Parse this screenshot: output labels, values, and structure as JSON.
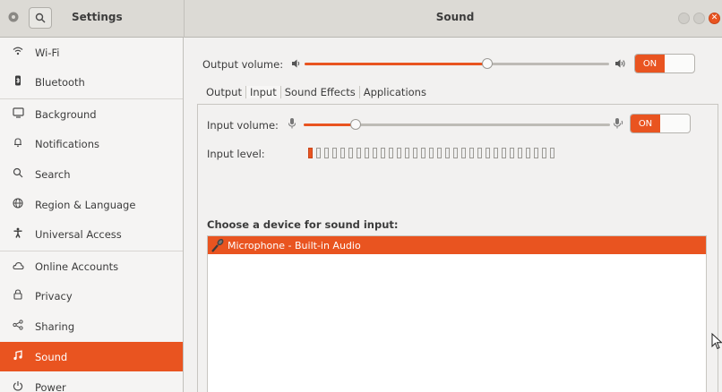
{
  "titlebar": {
    "app_title": "Settings",
    "window_title": "Sound"
  },
  "sidebar": {
    "items": [
      {
        "label": "Wi-Fi",
        "icon": "wifi-icon"
      },
      {
        "label": "Bluetooth",
        "icon": "bluetooth-icon"
      },
      {
        "label": "Background",
        "icon": "background-icon"
      },
      {
        "label": "Notifications",
        "icon": "bell-icon"
      },
      {
        "label": "Search",
        "icon": "search-icon"
      },
      {
        "label": "Region & Language",
        "icon": "globe-icon"
      },
      {
        "label": "Universal Access",
        "icon": "accessibility-icon"
      },
      {
        "label": "Online Accounts",
        "icon": "cloud-icon"
      },
      {
        "label": "Privacy",
        "icon": "lock-icon"
      },
      {
        "label": "Sharing",
        "icon": "share-icon"
      },
      {
        "label": "Sound",
        "icon": "music-note-icon",
        "active": true
      },
      {
        "label": "Power",
        "icon": "power-icon"
      }
    ]
  },
  "output": {
    "volume_label": "Output volume:",
    "volume_percent": 0.6,
    "toggle_label": "ON"
  },
  "tabs": [
    "Output",
    "Input",
    "Sound Effects",
    "Applications"
  ],
  "active_tab": "Input",
  "input": {
    "volume_label": "Input volume:",
    "volume_percent": 0.17,
    "toggle_label": "ON",
    "level_label": "Input level:",
    "level_bars_total": 31,
    "level_bars_active": 1
  },
  "devices": {
    "heading": "Choose a device for sound input:",
    "items": [
      {
        "name": "Microphone - Built-in Audio",
        "selected": true
      }
    ]
  },
  "colors": {
    "accent": "#e95420",
    "sidebar_bg": "#f5f4f3",
    "window_bg": "#f2f1f0"
  }
}
